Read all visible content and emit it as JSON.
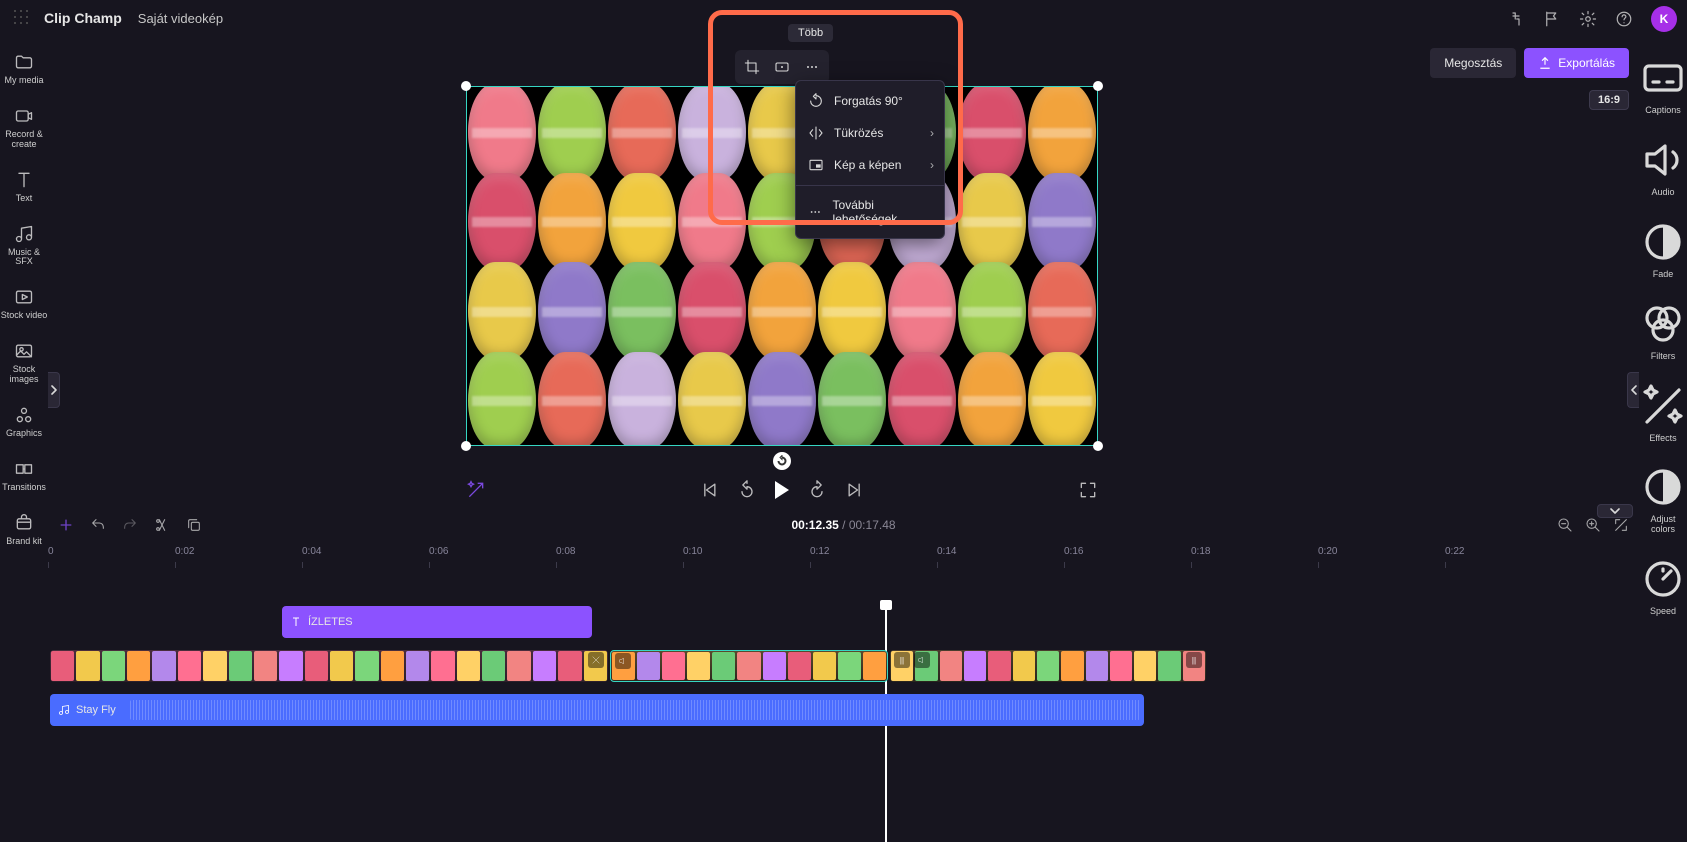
{
  "app": {
    "name": "Clip Champ",
    "project": "Saját videokép"
  },
  "topbar": {
    "avatar_initial": "K"
  },
  "actions": {
    "share": "Megosztás",
    "export": "Exportálás",
    "ratio": "16:9"
  },
  "left_sidebar": [
    {
      "id": "my-media",
      "label": "My media"
    },
    {
      "id": "record-create",
      "label": "Record &\ncreate"
    },
    {
      "id": "text",
      "label": "Text"
    },
    {
      "id": "music-sfx",
      "label": "Music & SFX"
    },
    {
      "id": "stock-video",
      "label": "Stock video"
    },
    {
      "id": "stock-images",
      "label": "Stock\nimages"
    },
    {
      "id": "graphics",
      "label": "Graphics"
    },
    {
      "id": "transitions",
      "label": "Transitions"
    },
    {
      "id": "brand-kit",
      "label": "Brand kit"
    }
  ],
  "right_sidebar": [
    {
      "id": "captions",
      "label": "Captions"
    },
    {
      "id": "audio",
      "label": "Audio"
    },
    {
      "id": "fade",
      "label": "Fade"
    },
    {
      "id": "filters",
      "label": "Filters"
    },
    {
      "id": "effects",
      "label": "Effects"
    },
    {
      "id": "adjust-colors",
      "label": "Adjust\ncolors"
    },
    {
      "id": "speed",
      "label": "Speed"
    }
  ],
  "float_toolbar": {
    "tooltip": "Több"
  },
  "context_menu": [
    {
      "id": "rotate",
      "label": "Forgatás 90°",
      "submenu": false
    },
    {
      "id": "mirror",
      "label": "Tükrözés",
      "submenu": true
    },
    {
      "id": "pip",
      "label": "Kép a képen",
      "submenu": true
    },
    {
      "_sep": true
    },
    {
      "id": "more",
      "label": "További lehetőségek",
      "submenu": false
    }
  ],
  "time": {
    "current": "00:12.35",
    "duration": "00:17.48"
  },
  "ruler": [
    "0",
    "0:02",
    "0:04",
    "0:06",
    "0:08",
    "0:10",
    "0:12",
    "0:14",
    "0:16",
    "0:18",
    "0:20",
    "0:22"
  ],
  "tracks": {
    "text_clip": {
      "label": "ÍZLETES"
    },
    "audio_clip": {
      "label": "Stay Fly"
    }
  },
  "thumb_palette": [
    "#e85d7a",
    "#f2c94c",
    "#7bd67b",
    "#ff9f40",
    "#b388eb",
    "#ff6f91",
    "#ffd166",
    "#6bcB77",
    "#f28482",
    "#c77dff"
  ]
}
